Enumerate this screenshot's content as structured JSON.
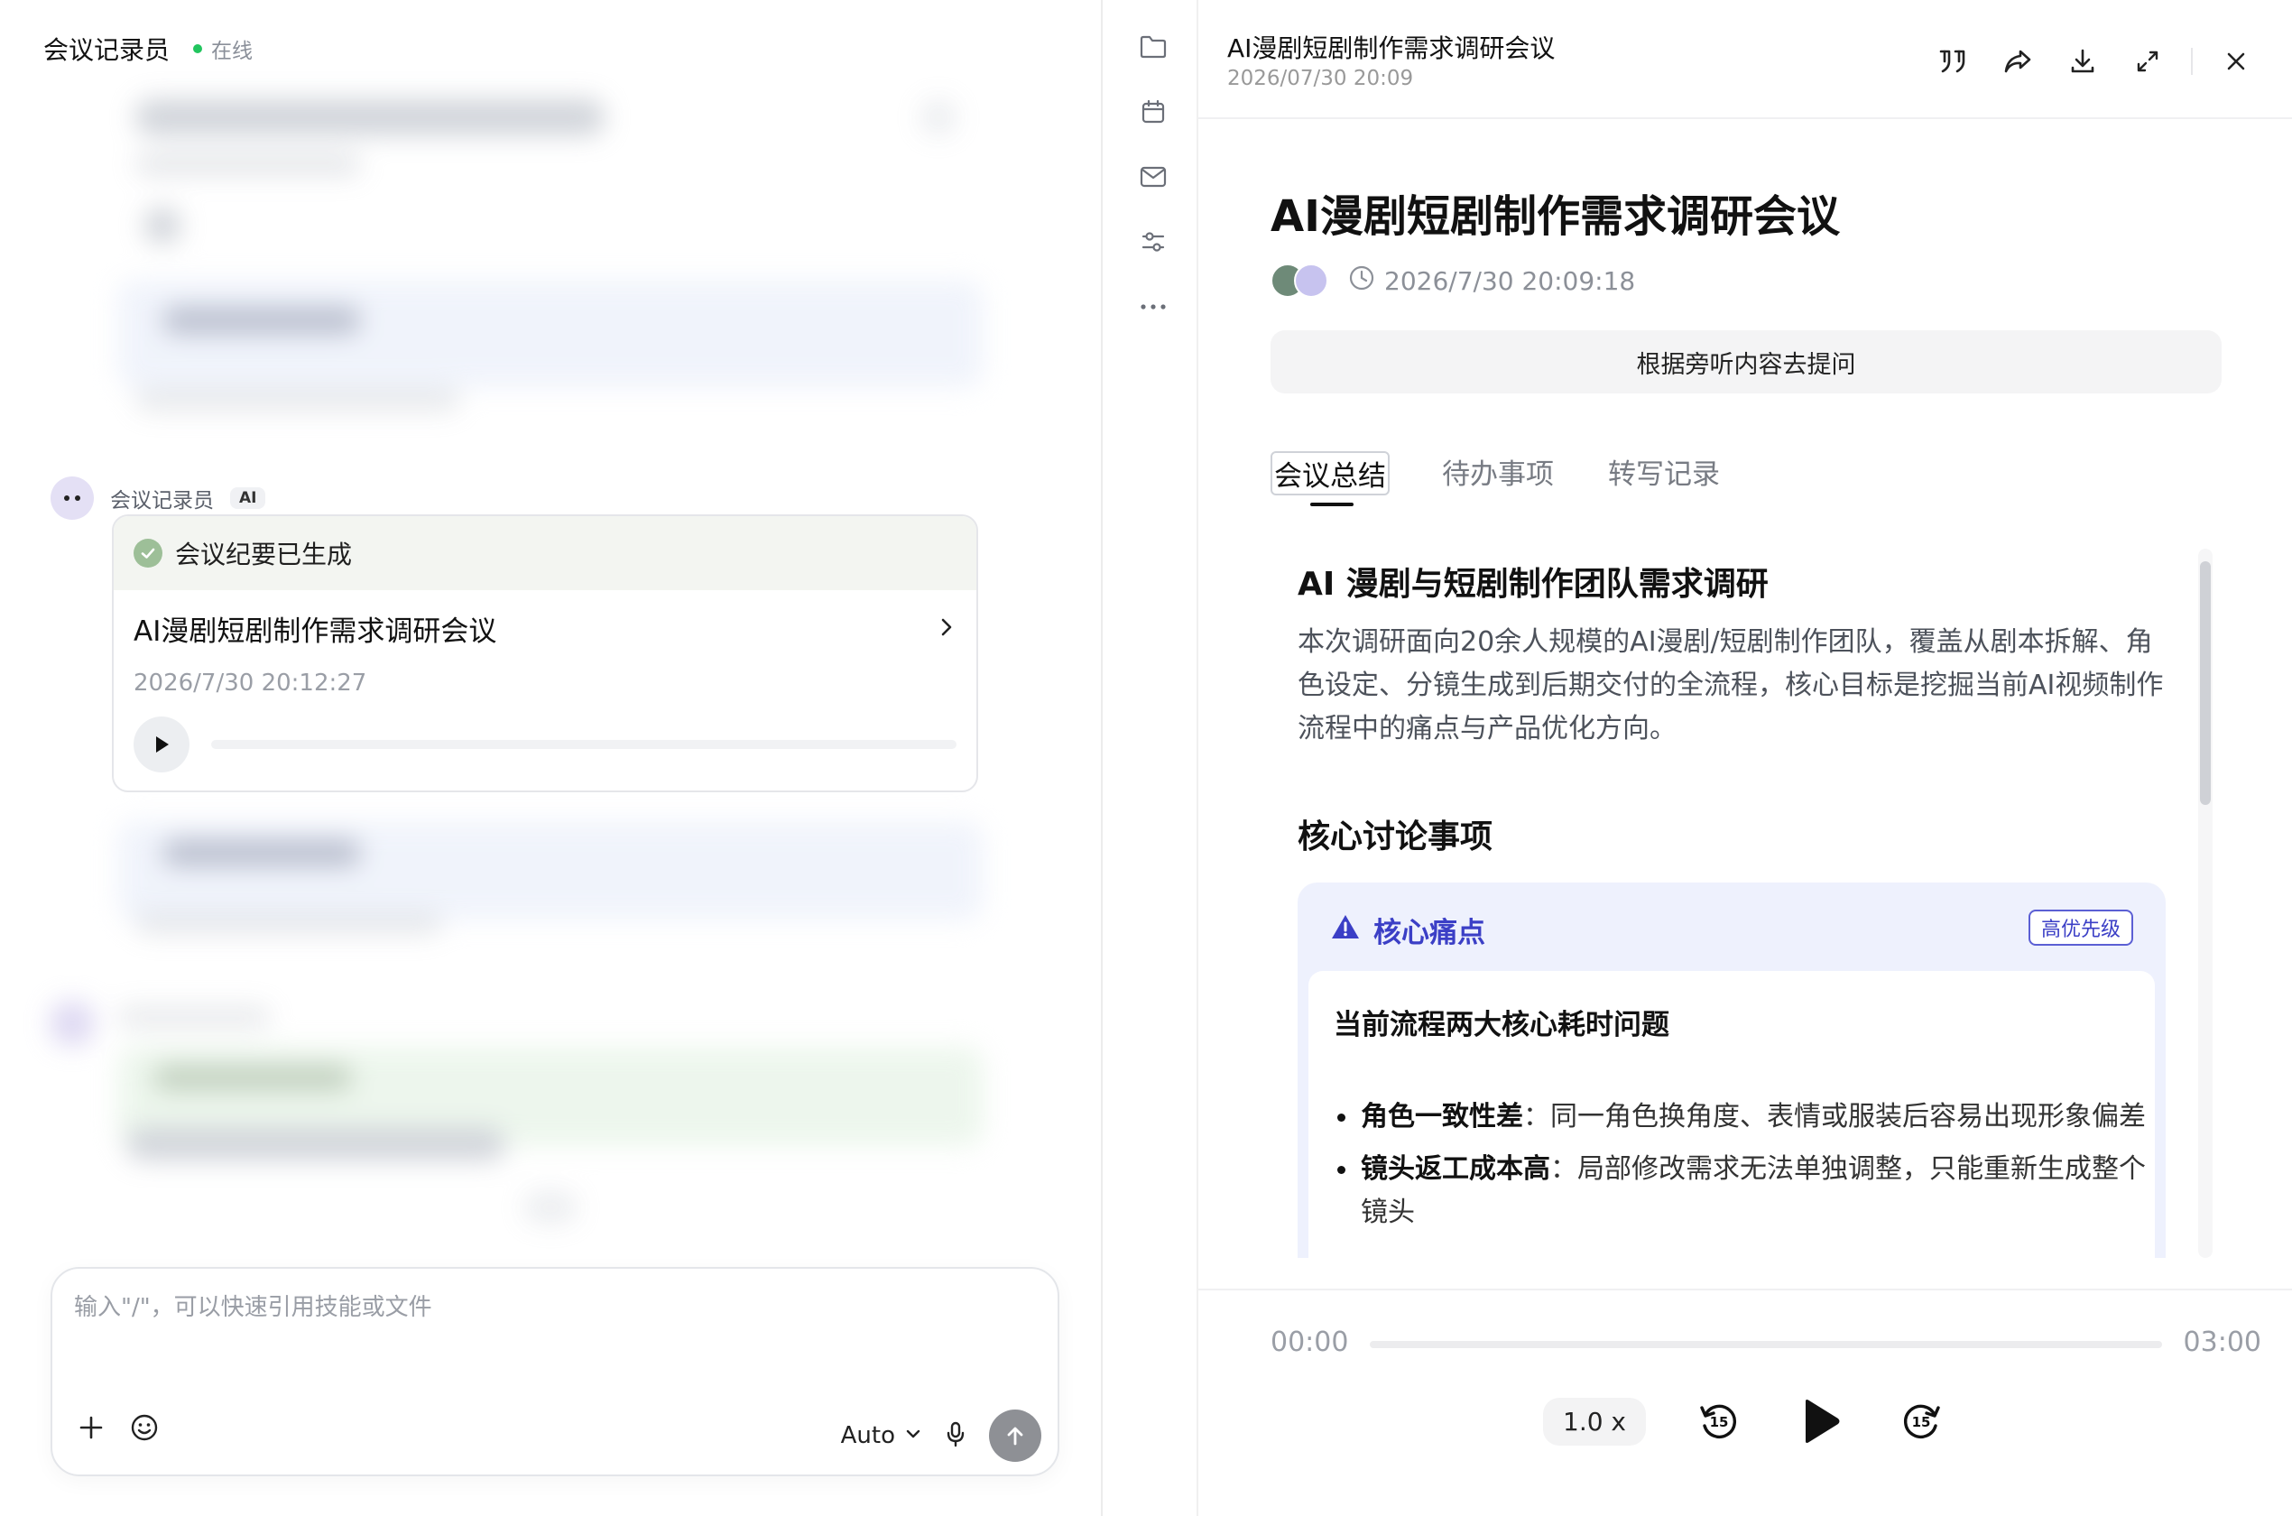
{
  "left": {
    "app_name": "会议记录员",
    "status": "在线",
    "message": {
      "sender": "会议记录员",
      "badge": "AI",
      "card_status": "会议纪要已生成",
      "title": "AI漫剧短剧制作需求调研会议",
      "time": "2026/7/30 20:12:27"
    },
    "composer": {
      "placeholder": "输入\"/\"，可以快速引用技能或文件",
      "model": "Auto"
    }
  },
  "right": {
    "header_title": "AI漫剧短剧制作需求调研会议",
    "header_time": "2026/07/30 20:09",
    "doc_title": "AI漫剧短剧制作需求调研会议",
    "doc_time": "2026/7/30 20:09:18",
    "ask_label": "根据旁听内容去提问",
    "tabs": [
      {
        "label": "会议总结",
        "active": true
      },
      {
        "label": "待办事项",
        "active": false
      },
      {
        "label": "转写记录",
        "active": false
      }
    ],
    "summary": {
      "heading": "AI 漫剧与短剧制作团队需求调研",
      "intro": "本次调研面向20余人规模的AI漫剧/短剧制作团队，覆盖从剧本拆解、角色设定、分镜生成到后期交付的全流程，核心目标是挖掘当前AI视频制作流程中的痛点与产品优化方向。",
      "section_title": "核心讨论事项",
      "pain": {
        "title": "核心痛点",
        "priority": "高优先级",
        "subtitle": "当前流程两大核心耗时问题",
        "items": [
          {
            "term": "角色一致性差",
            "sep": "：",
            "desc": "同一角色换角度、表情或服装后容易出现形象偏差"
          },
          {
            "term": "镜头返工成本高",
            "sep": "：",
            "desc": "局部修改需求无法单独调整，只能重新生成整个镜头"
          }
        ]
      }
    },
    "player": {
      "current": "00:00",
      "total": "03:00",
      "speed": "1.0 x",
      "progress": 0
    }
  },
  "colors": {
    "accent": "#3b3fc6",
    "online": "#22c55e",
    "card_bg": "#eef1fd"
  }
}
